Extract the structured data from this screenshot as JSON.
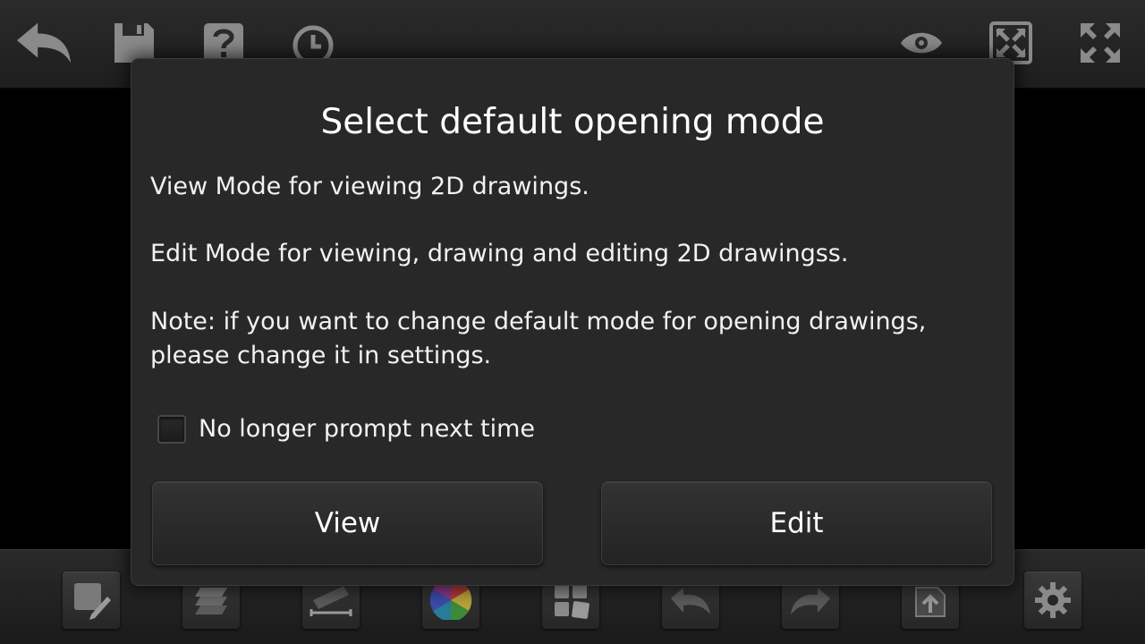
{
  "top_toolbar": {
    "buttons": [
      "back-icon",
      "save-icon",
      "help-icon",
      "history-icon",
      "view-eye-icon",
      "fit-screen-icon",
      "fullscreen-icon"
    ]
  },
  "bottom_toolbar": {
    "buttons": [
      "edit-drawing-icon",
      "layers-icon",
      "measure-icon",
      "color-wheel-icon",
      "blocks-icon",
      "undo-icon",
      "redo-icon",
      "export-icon",
      "settings-icon"
    ]
  },
  "dialog": {
    "title": "Select default opening mode",
    "line1": "View Mode for viewing 2D drawings.",
    "line2": "Edit Mode for viewing, drawing and editing 2D drawingss.",
    "line3a": "Note: if you want to change default mode for opening drawings,",
    "line3b": "please change it in settings.",
    "checkbox_label": "No longer prompt next time",
    "checkbox_checked": false,
    "view_button": "View",
    "edit_button": "Edit"
  },
  "colors": {
    "dialog_bg": "#282828",
    "text": "#f2f2f2",
    "icon": "#8a8a8a"
  }
}
